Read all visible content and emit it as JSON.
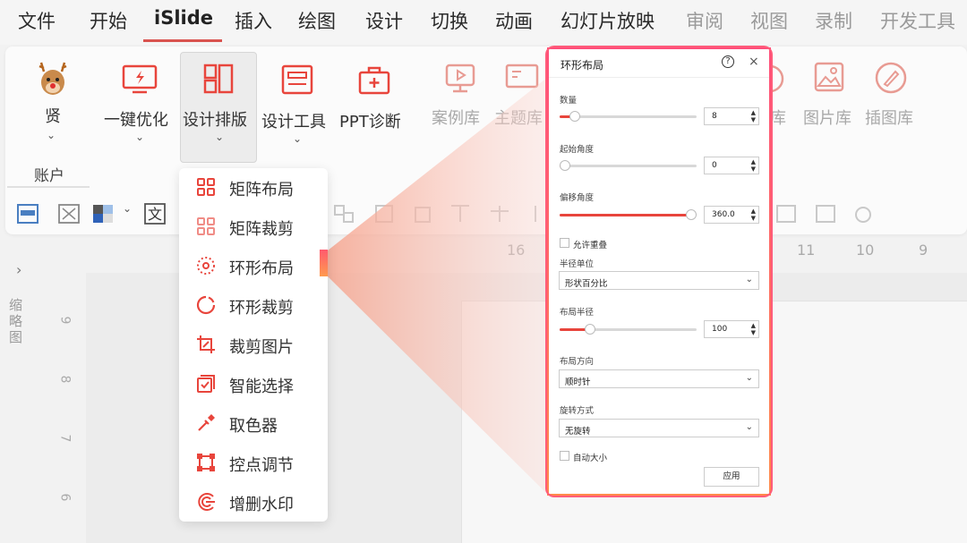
{
  "menu": {
    "items": [
      "文件",
      "开始",
      "iSlide",
      "插入",
      "绘图",
      "设计",
      "切换",
      "动画",
      "幻灯片放映",
      "审阅",
      "视图",
      "录制",
      "开发工具"
    ]
  },
  "ribbon": {
    "account_name": "贤",
    "account_group": "账户",
    "buttons": [
      {
        "label": "一键优化"
      },
      {
        "label": "设计排版"
      },
      {
        "label": "设计工具"
      },
      {
        "label": "PPT诊断"
      },
      {
        "label": "案例库"
      },
      {
        "label": "主题库"
      },
      {
        "label": "库"
      },
      {
        "label": "图片库"
      },
      {
        "label": "插图库"
      }
    ]
  },
  "left_pane": {
    "arrow": "›",
    "label": "缩略图"
  },
  "ruler": {
    "h_numbers": [
      "16",
      "11",
      "10",
      "9"
    ],
    "v_numbers": [
      "9",
      "8",
      "7",
      "6"
    ]
  },
  "dropdown": {
    "items": [
      {
        "label": "矩阵布局",
        "icon": "grid-icon"
      },
      {
        "label": "矩阵裁剪",
        "icon": "grid-crop-icon"
      },
      {
        "label": "环形布局",
        "icon": "ring-layout-icon"
      },
      {
        "label": "环形裁剪",
        "icon": "ring-crop-icon"
      },
      {
        "label": "裁剪图片",
        "icon": "crop-icon"
      },
      {
        "label": "智能选择",
        "icon": "smart-select-icon"
      },
      {
        "label": "取色器",
        "icon": "eyedropper-icon"
      },
      {
        "label": "控点调节",
        "icon": "control-point-icon"
      },
      {
        "label": "增删水印",
        "icon": "watermark-icon"
      }
    ]
  },
  "dialog": {
    "title": "环形布局",
    "help": "?",
    "close": "×",
    "count": {
      "label": "数量",
      "value": "8",
      "fraction": 0.08
    },
    "start_angle": {
      "label": "起始角度",
      "value": "0",
      "fraction": 0.0
    },
    "offset_angle": {
      "label": "偏移角度",
      "value": "360.0",
      "fraction": 1.0
    },
    "allow_overlap": {
      "label": "允许重叠"
    },
    "radius_unit": {
      "label": "半径单位",
      "value": "形状百分比"
    },
    "layout_radius": {
      "label": "布局半径",
      "value": "100",
      "fraction": 0.2
    },
    "layout_direction": {
      "label": "布局方向",
      "value": "顺时针"
    },
    "rotation_mode": {
      "label": "旋转方式",
      "value": "无旋转"
    },
    "auto_size": {
      "label": "自动大小"
    },
    "apply": "应用"
  },
  "colors": {
    "accent": "#e8453c",
    "highlight_gradient_start": "#ff4d7a",
    "highlight_gradient_end": "#ff8a4a"
  }
}
